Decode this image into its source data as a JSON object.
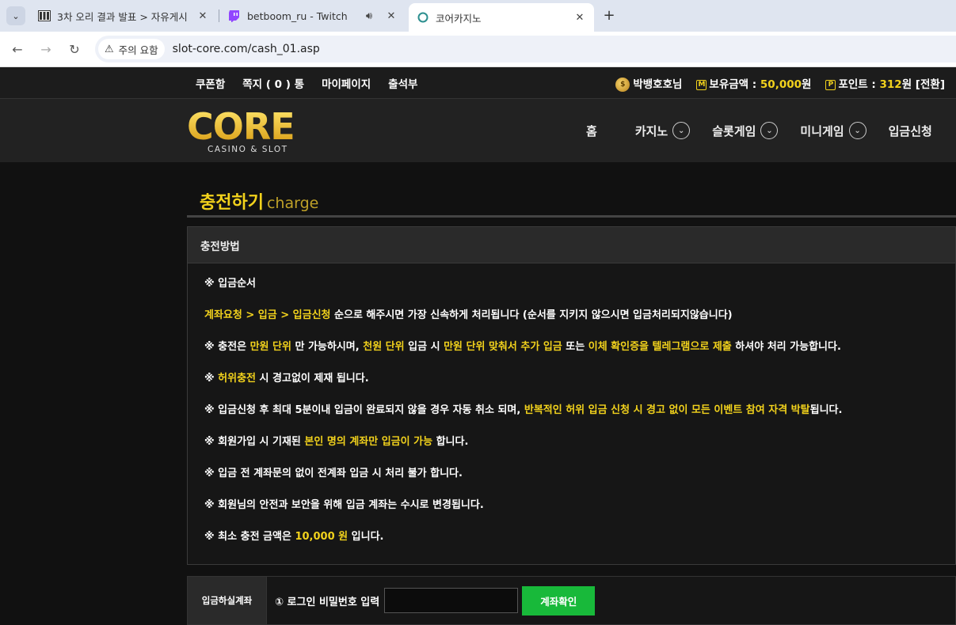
{
  "browser": {
    "tabs": [
      {
        "title": "3차 오리 결과 발표 > 자유게시",
        "icon": "film-icon"
      },
      {
        "title": "betboom_ru - Twitch",
        "icon": "twitch-icon"
      },
      {
        "title": "코어카지노",
        "icon": "loading-circle-icon"
      }
    ],
    "security_chip": "주의 요함",
    "url": "slot-core.com/cash_01.asp"
  },
  "topnav": {
    "links": [
      "쿠폰함",
      "쪽지 ( 0 ) 통",
      "마이페이지",
      "출석부"
    ],
    "user": "박뱅호호님",
    "balance_label": "보유금액 : ",
    "balance_value": "50,000",
    "balance_unit": "원",
    "point_label": "포인트 : ",
    "point_value": "312",
    "point_unit": "원 [전환]"
  },
  "logo": {
    "word": "CORE",
    "sub": "CASINO & SLOT"
  },
  "mainnav": [
    "홈",
    "카지노",
    "슬롯게임",
    "미니게임",
    "입금신청"
  ],
  "page": {
    "title": "충전하기",
    "title_en": "charge"
  },
  "panel": {
    "heading": "충전방법",
    "l1": "※ 입금순서",
    "l2_hl": "계좌요청 > 입금 > 입금신청",
    "l2_rest": " 순으로 해주시면 가장 신속하게 처리됩니다 (순서를 지키지 않으시면 입금처리되지않습니다)",
    "l3_a": "※ 충전은 ",
    "l3_b": "만원 단위",
    "l3_c": " 만 가능하시며, ",
    "l3_d": "천원 단위",
    "l3_e": " 입금 시 ",
    "l3_f": "만원 단위 맞춰서 추가 입금",
    "l3_g": " 또는 ",
    "l3_h": "이체 확인증을 텔레그램으로 제출",
    "l3_i": " 하셔야 처리 가능합니다.",
    "l4_a": "※ ",
    "l4_b": "허위충전",
    "l4_c": " 시 경고없이 제재 됩니다.",
    "l5_a": "※ 입금신청 후 최대 5분이내 입금이 완료되지 않을 경우 자동 취소 되며, ",
    "l5_b": "반복적인 허위 입금 신청 시 경고 없이 모든 이벤트 참여 자격 박탈",
    "l5_c": "됩니다.",
    "l6_a": "※ 회원가입 시 기재된 ",
    "l6_b": "본인 명의 계좌만 입금이 가능",
    "l6_c": " 합니다.",
    "l7": "※ 입금 전 계좌문의 없이 전계좌 입금 시 처리 불가 합니다.",
    "l8": "※ 회원님의 안전과 보안을 위해 입금 계좌는 수시로 변경됩니다.",
    "l9_a": "※ 최소 충전 금액은 ",
    "l9_b": "10,000 원",
    "l9_c": " 입니다."
  },
  "form": {
    "label": "입금하실계좌",
    "text": "① 로그인 비밀번호 입력",
    "button": "계좌확인"
  },
  "colors": {
    "accent": "#f2d21c",
    "button_green": "#18b93a",
    "bg": "#111111"
  }
}
